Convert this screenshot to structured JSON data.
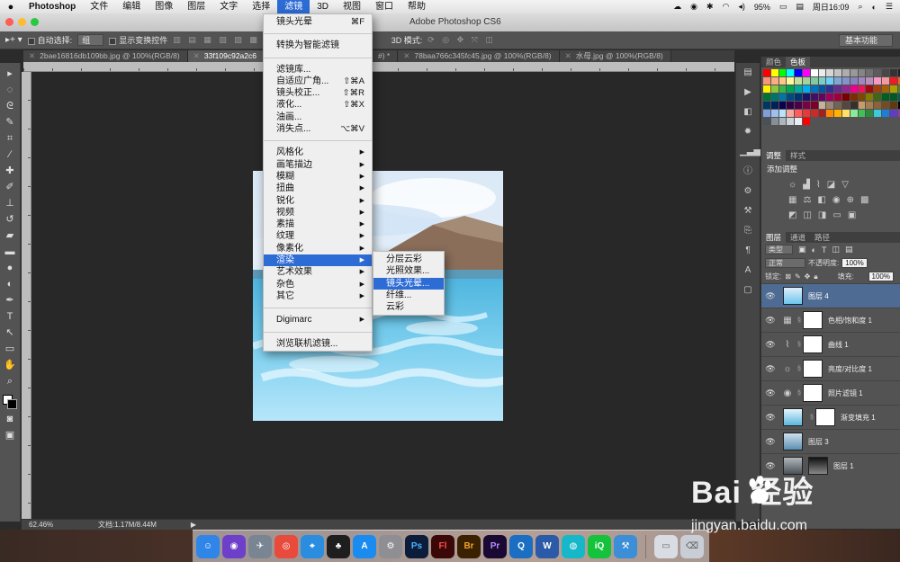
{
  "menubar": {
    "app_name": "Photoshop",
    "items": [
      "文件",
      "编辑",
      "图像",
      "图层",
      "文字",
      "选择",
      "滤镜",
      "3D",
      "视图",
      "窗口",
      "帮助"
    ],
    "active": "滤镜",
    "battery": "95%",
    "clock": "周日16:09"
  },
  "window": {
    "title": "Adobe Photoshop CS6"
  },
  "options": {
    "auto_select_label": "自动选择:",
    "auto_select_value": "组",
    "show_transform_label": "显示变换控件",
    "mode3d_label": "3D 模式:",
    "workspace": "基本功能"
  },
  "tabs": [
    {
      "label": "2bae16816db109bb.jpg @ 100%(RGB/8)",
      "active": false
    },
    {
      "label": "33f109c92a2c6",
      "active": true
    },
    {
      "label": "#) *",
      "active": false
    },
    {
      "label": "78baa766c345fc45.jpg @ 100%(RGB/8)",
      "active": false
    },
    {
      "label": "水母.jpg @ 100%(RGB/8)",
      "active": false
    }
  ],
  "status": {
    "zoom": "62.46%",
    "doc": "文档:1.17M/8.44M"
  },
  "filter_menu": {
    "items": [
      {
        "label": "镜头光晕",
        "shortcut": "⌘F"
      },
      {
        "sep": true
      },
      {
        "label": "转换为智能滤镜"
      },
      {
        "sep": true
      },
      {
        "label": "滤镜库..."
      },
      {
        "label": "自适应广角...",
        "shortcut": "⇧⌘A"
      },
      {
        "label": "镜头校正...",
        "shortcut": "⇧⌘R"
      },
      {
        "label": "液化...",
        "shortcut": "⇧⌘X"
      },
      {
        "label": "油画..."
      },
      {
        "label": "消失点...",
        "shortcut": "⌥⌘V"
      },
      {
        "sep": true
      },
      {
        "label": "风格化",
        "sub": true
      },
      {
        "label": "画笔描边",
        "sub": true
      },
      {
        "label": "模糊",
        "sub": true
      },
      {
        "label": "扭曲",
        "sub": true
      },
      {
        "label": "锐化",
        "sub": true
      },
      {
        "label": "视频",
        "sub": true
      },
      {
        "label": "素描",
        "sub": true
      },
      {
        "label": "纹理",
        "sub": true
      },
      {
        "label": "像素化",
        "sub": true
      },
      {
        "label": "渲染",
        "sub": true,
        "highlight": true
      },
      {
        "label": "艺术效果",
        "sub": true
      },
      {
        "label": "杂色",
        "sub": true
      },
      {
        "label": "其它",
        "sub": true
      },
      {
        "sep": true
      },
      {
        "label": "Digimarc",
        "sub": true
      },
      {
        "sep": true
      },
      {
        "label": "浏览联机滤镜..."
      }
    ]
  },
  "render_submenu": {
    "items": [
      {
        "label": "分层云彩"
      },
      {
        "label": "光照效果..."
      },
      {
        "label": "镜头光晕...",
        "highlight": true
      },
      {
        "label": "纤维..."
      },
      {
        "label": "云彩"
      }
    ]
  },
  "panels": {
    "swatch_tabs": [
      "颜色",
      "色板"
    ],
    "adjust_tabs": [
      "调整",
      "样式"
    ],
    "adjust_title": "添加调整",
    "layer_tabs": [
      "图层",
      "通道",
      "路径"
    ],
    "filter_kind": "类型",
    "blend_mode": "正常",
    "opacity_label": "不透明度:",
    "opacity": "100%",
    "lock_label": "锁定:",
    "fill_label": "填充:",
    "fill": "100%",
    "layers": [
      {
        "name": "图层 4",
        "selected": true,
        "kind": "image"
      },
      {
        "name": "色相/饱和度 1",
        "kind": "adj",
        "icon": "▦"
      },
      {
        "name": "曲线 1",
        "kind": "adj",
        "icon": "⌇"
      },
      {
        "name": "亮度/对比度 1",
        "kind": "adj",
        "icon": "☼"
      },
      {
        "name": "照片滤镜 1",
        "kind": "adj",
        "icon": "◉"
      },
      {
        "name": "渐变填充 1",
        "kind": "grad"
      },
      {
        "name": "图层 3",
        "kind": "image"
      },
      {
        "name": "图层 1",
        "kind": "image"
      }
    ]
  },
  "watermark": {
    "brand": "Bai  经验",
    "url": "jingyan.baidu.com"
  },
  "colors": {
    "menu_highlight": "#2d6bd5",
    "layer_selected": "#4e6b93"
  }
}
